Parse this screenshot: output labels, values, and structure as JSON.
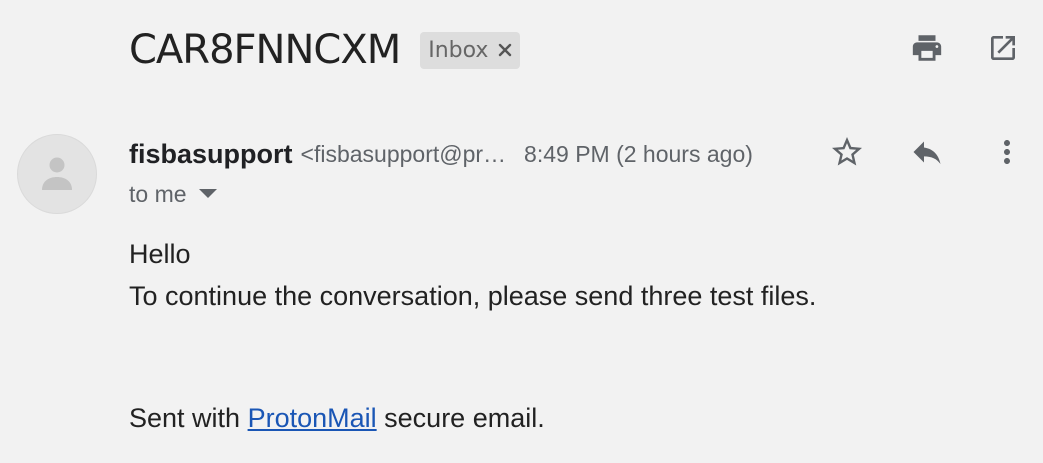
{
  "subject": "CAR8FNNCXM",
  "label_chip": {
    "label": "Inbox",
    "remove_icon": "close-icon"
  },
  "toolbar": {
    "print_icon": "print-icon",
    "popout_icon": "open-in-new-icon"
  },
  "message": {
    "avatar_icon": "person-icon",
    "sender_name": "fisbasupport",
    "sender_email": "<fisbasupport@pr…",
    "time": "8:49 PM (2 hours ago)",
    "recipient": "to me",
    "actions": {
      "star_icon": "star-outline-icon",
      "reply_icon": "reply-icon",
      "more_icon": "more-vert-icon"
    },
    "body_lines": [
      "Hello",
      "To continue the conversation, please send three test files."
    ],
    "signature": {
      "prefix": "Sent with",
      "link_text": "ProtonMail",
      "suffix": "secure email."
    }
  },
  "colors": {
    "background": "#f2f2f2",
    "chip_background": "#dddddd",
    "link": "#1a56b5",
    "secondary_text": "#5f6368",
    "icon": "#5f6368"
  }
}
